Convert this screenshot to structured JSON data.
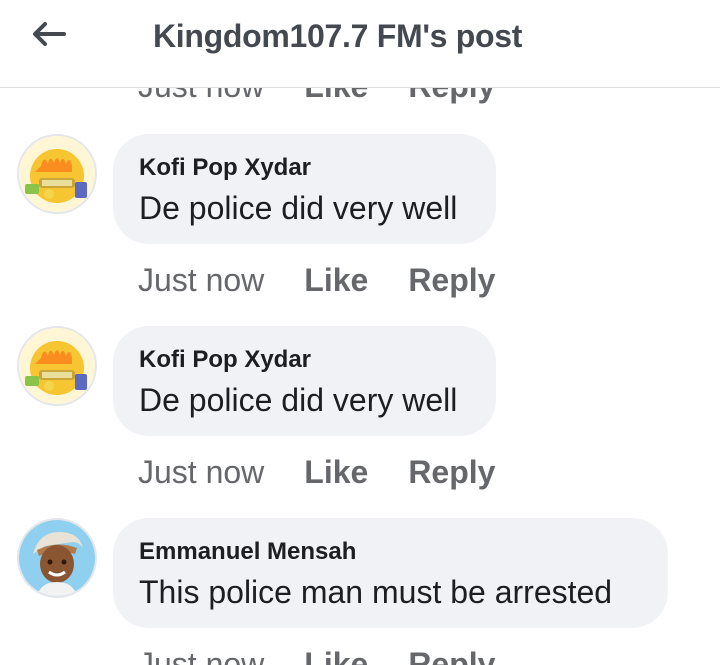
{
  "header": {
    "title": "Kingdom107.7 FM's post",
    "back_icon": "arrow-left-icon"
  },
  "comments": [
    {
      "time": "Just now",
      "like": "Like",
      "reply": "Reply"
    },
    {
      "author": "Kofi Pop Xydar",
      "text": "De police did very well",
      "time": "Just now",
      "like": "Like",
      "reply": "Reply",
      "avatar": "emoji-avatar"
    },
    {
      "author": "Kofi Pop Xydar",
      "text": "De police did very well",
      "time": "Just now",
      "like": "Like",
      "reply": "Reply",
      "avatar": "emoji-avatar"
    },
    {
      "author": "Emmanuel Mensah",
      "text": "This police man must be arrested",
      "time": "Just now",
      "like": "Like",
      "reply": "Reply",
      "avatar": "person-avatar"
    }
  ],
  "colors": {
    "bubble": "#f0f2f5",
    "secondary_text": "#65676b",
    "primary_text": "#1c1e21",
    "divider": "#dcdee2"
  }
}
